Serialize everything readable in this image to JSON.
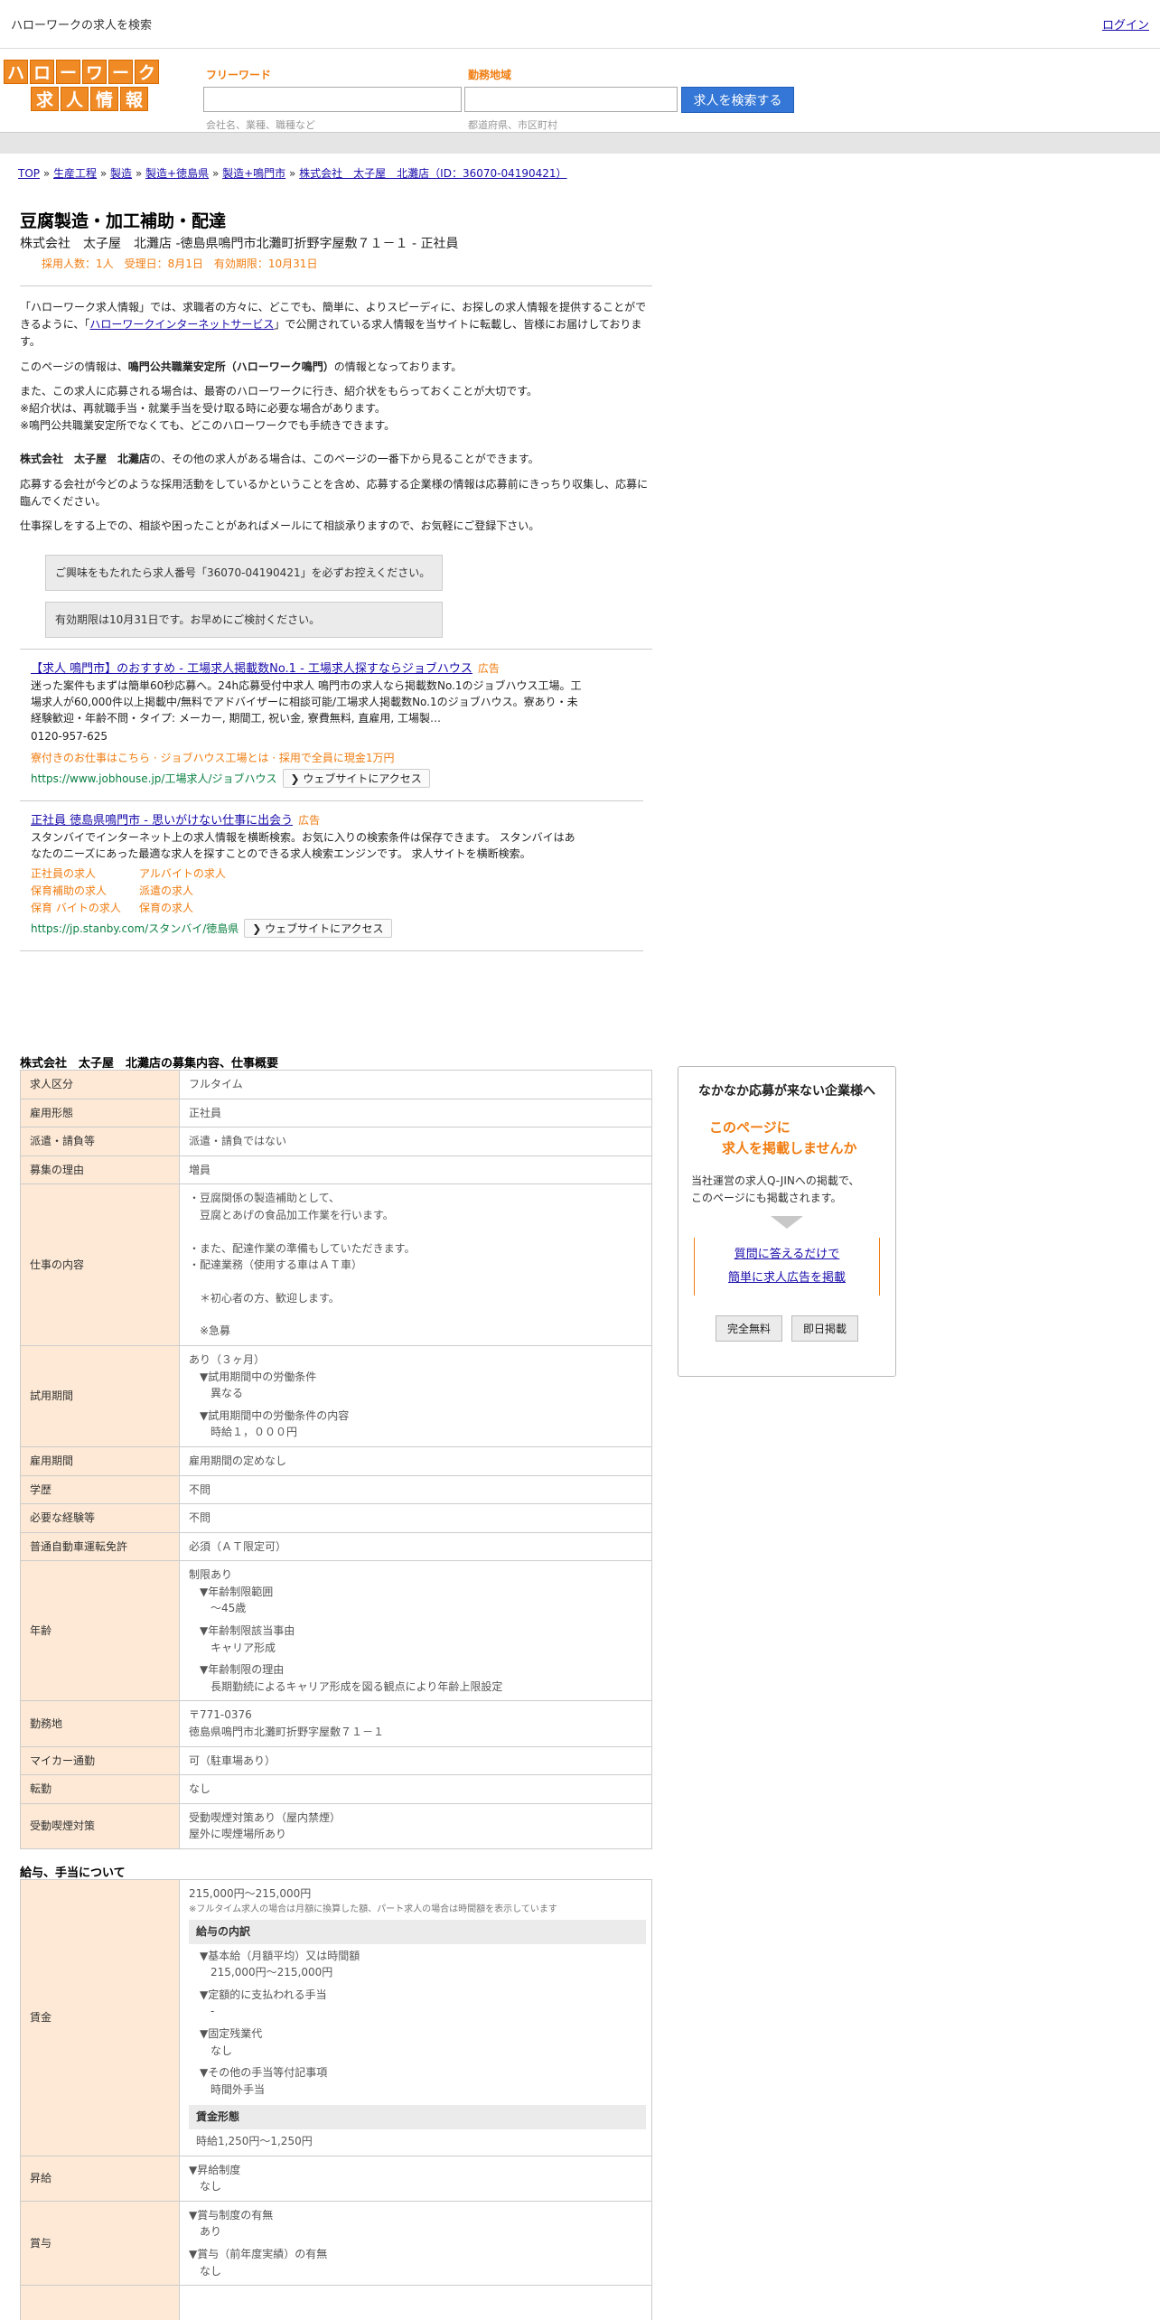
{
  "topbar": {
    "site_name": "ハローワークの求人を検索",
    "login": "ログイン"
  },
  "logo": {
    "row1": [
      "ハ",
      "ロ",
      "ー",
      "ワ",
      "ー",
      "ク"
    ],
    "row2": [
      "求",
      "人",
      "情",
      "報"
    ]
  },
  "search": {
    "freeword_label": "フリーワード",
    "freeword_hint": "会社名、業種、職種など",
    "area_label": "勤務地域",
    "area_hint": "都道府県、市区町村",
    "button": "求人を検索する"
  },
  "breadcrumb": {
    "items": [
      "TOP",
      "生産工程",
      "製造",
      "製造+徳島県",
      "製造+鳴門市",
      "株式会社　太子屋　北灘店（ID：36070-04190421）"
    ],
    "sep": "»"
  },
  "job": {
    "title": "豆腐製造・加工補助・配達",
    "company_line": "株式会社　太子屋　北灘店 -徳島県鳴門市北灘町折野字屋敷７１－１ - 正社員",
    "meta": "採用人数：1人　受理日：8月1日　有効期限：10月31日"
  },
  "intro": {
    "p1_a": "「ハローワーク求人情報」では、求職者の方々に、どこでも、簡単に、よりスピーディに、お探しの求人情報を提供することができるように、「",
    "p1_link": "ハローワークインターネットサービス",
    "p1_b": "」で公開されている求人情報を当サイトに転載し、皆様にお届けしております。",
    "p2_a": "このページの情報は、",
    "p2_bold": "鳴門公共職業安定所（ハローワーク鳴門）",
    "p2_b": "の情報となっております。",
    "p3_l1": "また、この求人に応募される場合は、最寄のハローワークに行き、紹介状をもらっておくことが大切です。",
    "p3_l2": "※紹介状は、再就職手当・就業手当を受け取る時に必要な場合があります。",
    "p3_l3": "※鳴門公共職業安定所でなくても、どこのハローワークでも手続きできます。",
    "p4_bold": "株式会社　太子屋　北灘店",
    "p4_b": "の、その他の求人がある場合は、このページの一番下から見ることができます。",
    "p5": "応募する会社が今どのような採用活動をしているかということを含め、応募する企業様の情報は応募前にきっちり収集し、応募に臨んでください。",
    "p6": "仕事探しをする上での、相談や困ったことがあればメールにて相談承りますので、お気軽にご登録下さい。",
    "notice1": "ご興味をもたれたら求人番号「36070-04190421」を必ずお控えください。",
    "notice2": "有効期限は10月31日です。お早めにご検討ください。"
  },
  "ads": [
    {
      "title": "【求人 鳴門市】のおすすめ - 工場求人掲載数No.1 - 工場求人探すならジョブハウス",
      "tag": "広告",
      "body": "迷った案件もまずは簡単60秒応募へ。24h応募受付中求人 鳴門市の求人なら掲載数No.1のジョブハウス工場。工場求人が60,000件以上掲載中/無料でアドバイザーに相談可能/工場求人掲載数No.1のジョブハウス。寮あり・未経験歓迎・年齢不問・タイプ: メーカー, 期間工, 祝い金, 寮費無料, 直雇用, 工場製…",
      "phone": "0120-957-625",
      "orange": "寮付きのお仕事はこちら · ジョブハウス工場とは · 採用で全員に現金1万円",
      "url": "https://www.jobhouse.jp/工場求人/ジョブハウス",
      "visit": "❯ ウェブサイトにアクセス"
    },
    {
      "title": "正社員 徳島県鳴門市 - 思いがけない仕事に出会う",
      "tag": "広告",
      "body": "スタンバイでインターネット上の求人情報を横断検索。お気に入りの検索条件は保存できます。 スタンバイはあなたのニーズにあった最適な求人を探すことのできる求人検索エンジンです。 求人サイトを横断検索。",
      "links": [
        "正社員の求人",
        "アルバイトの求人",
        "保育補助の求人",
        "派遣の求人",
        "保育 バイトの求人",
        "保育の求人"
      ],
      "url": "https://jp.stanby.com/スタンバイ/徳島県",
      "visit": "❯ ウェブサイトにアクセス"
    }
  ],
  "details": {
    "title": "株式会社　太子屋　北灘店の募集内容、仕事概要",
    "rows": {
      "kubun_k": "求人区分",
      "kubun_v": "フルタイム",
      "keitai_k": "雇用形態",
      "keitai_v": "正社員",
      "haken_k": "派遣・請負等",
      "haken_v": "派遣・請負ではない",
      "riyu_k": "募集の理由",
      "riyu_v": "増員",
      "naiyo_k": "仕事の内容",
      "naiyo_v": [
        "・豆腐関係の製造補助として、",
        "　豆腐とあげの食品加工作業を行います。",
        "",
        "・また、配達作業の準備もしていただきます。",
        "・配達業務（使用する車はＡＴ車）",
        "",
        "　＊初心者の方、歓迎します。",
        "",
        "　※急募"
      ],
      "shiyo_k": "試用期間",
      "shiyo_v1": "あり（３ヶ月）",
      "shiyo_v2": "▼試用期間中の労働条件",
      "shiyo_v3": "異なる",
      "shiyo_v4": "▼試用期間中の労働条件の内容",
      "shiyo_v5": "時給１，０００円",
      "kikan_k": "雇用期間",
      "kikan_v": "雇用期間の定めなし",
      "gakureki_k": "学歴",
      "gakureki_v": "不問",
      "keiken_k": "必要な経験等",
      "keiken_v": "不問",
      "menkyo_k": "普通自動車運転免許",
      "menkyo_v": "必須（ＡＴ限定可）",
      "nenrei_k": "年齢",
      "nenrei_v1": "制限あり",
      "nenrei_v2": "▼年齢制限範囲",
      "nenrei_v3": "〜45歳",
      "nenrei_v4": "▼年齢制限該当事由",
      "nenrei_v5": "キャリア形成",
      "nenrei_v6": "▼年齢制限の理由",
      "nenrei_v7": "長期勤続によるキャリア形成を図る観点により年齢上限設定",
      "kinmu_k": "勤務地",
      "kinmu_v1": "〒771-0376",
      "kinmu_v2": "徳島県鳴門市北灘町折野字屋敷７１－１",
      "mycar_k": "マイカー通勤",
      "mycar_v": "可（駐車場あり）",
      "tenkin_k": "転勤",
      "tenkin_v": "なし",
      "juki_k": "受動喫煙対策",
      "juki_v1": "受動喫煙対策あり（屋内禁煙）",
      "juki_v2": "屋外に喫煙場所あり"
    }
  },
  "salary": {
    "title": "給与、手当について",
    "chingin_k": "賃金",
    "range": "215,000円〜215,000円",
    "note": "※フルタイム求人の場合は月額に換算した額、パート求人の場合は時間額を表示しています",
    "breakdown_title": "給与の内訳",
    "b1": "▼基本給（月額平均）又は時間額",
    "b1v": "215,000円〜215,000円",
    "b2": "▼定額的に支払われる手当",
    "b2v": "-",
    "b3": "▼固定残業代",
    "b3v": "なし",
    "b4": "▼その他の手当等付記事項",
    "b4v": "時間外手当",
    "form_title": "賃金形態",
    "form_v": "時給1,250円〜1,250円",
    "shokyu_k": "昇給",
    "shokyu_v1": "▼昇給制度",
    "shokyu_v2": "なし",
    "shoyo_k": "賞与",
    "shoyo_v1": "▼賞与制度の有無",
    "shoyo_v2": "あり",
    "shoyo_v3": "▼賞与（前年度実績）の有無",
    "shoyo_v4": "なし"
  },
  "side": {
    "title": "なかなか応募が来ない企業様へ",
    "orange1": "このページに",
    "orange2": "求人を掲載しませんか",
    "desc1": "当社運営の求人Q-JINへの掲載で、",
    "desc2": "このページにも掲載されます。",
    "cta1": "質問に答えるだけで",
    "cta2": "簡単に求人広告を掲載",
    "btn1": "完全無料",
    "btn2": "即日掲載"
  }
}
